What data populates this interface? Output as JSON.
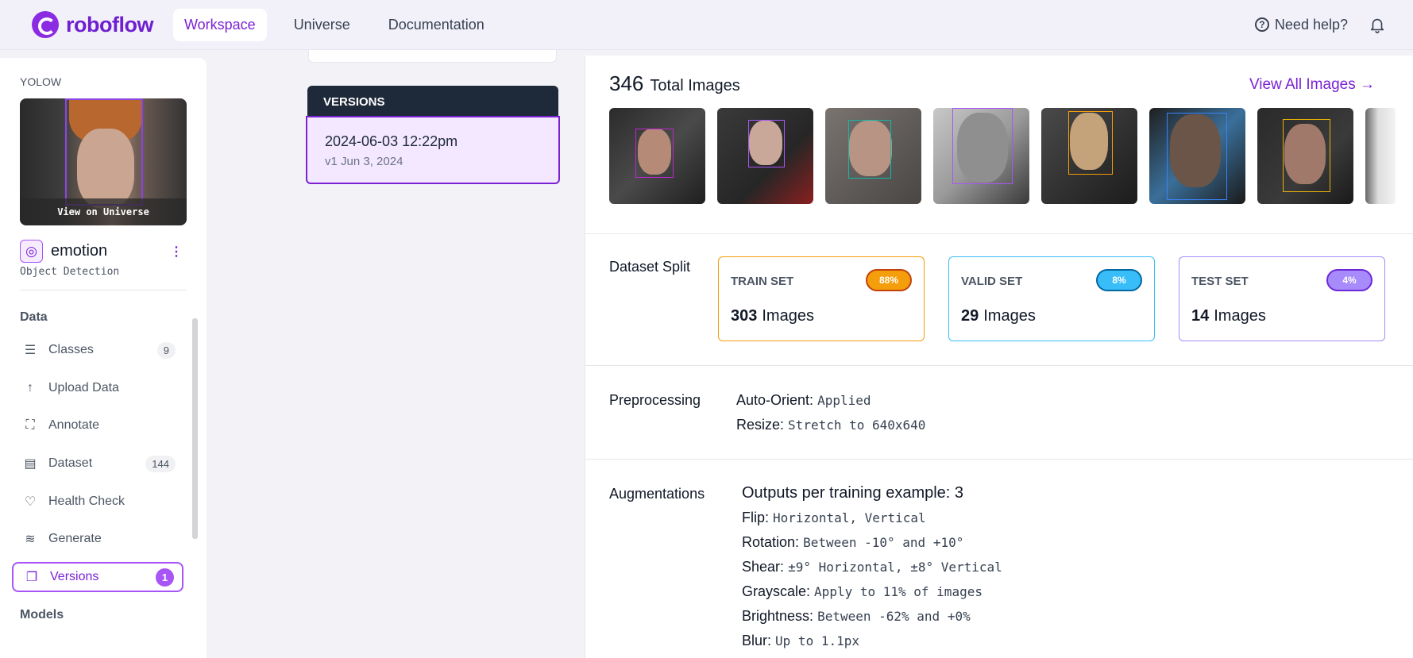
{
  "nav": {
    "logo_text": "roboflow",
    "links": [
      "Workspace",
      "Universe",
      "Documentation"
    ],
    "help_label": "Need help?"
  },
  "sidebar": {
    "owner": "YOLOW",
    "thumb_caption": "View on Universe",
    "project_name": "emotion",
    "project_type": "Object Detection",
    "sections": {
      "data": "Data",
      "models": "Models"
    },
    "items": [
      {
        "label": "Classes",
        "icon": "list-icon",
        "count": "9"
      },
      {
        "label": "Upload Data",
        "icon": "upload-icon",
        "count": ""
      },
      {
        "label": "Annotate",
        "icon": "annotate-icon",
        "count": ""
      },
      {
        "label": "Dataset",
        "icon": "dataset-icon",
        "count": "144"
      },
      {
        "label": "Health Check",
        "icon": "health-check-icon",
        "count": ""
      },
      {
        "label": "Generate",
        "icon": "generate-icon",
        "count": ""
      },
      {
        "label": "Versions",
        "icon": "versions-icon",
        "count": "1",
        "active": true
      }
    ]
  },
  "versions": {
    "header": "VERSIONS",
    "item": {
      "name": "2024-06-03 12:22pm",
      "sub": "v1 Jun 3, 2024"
    }
  },
  "main": {
    "total_count": "346",
    "total_label": "Total Images",
    "view_all": "View All Images →",
    "split": {
      "label": "Dataset Split",
      "cards": [
        {
          "title": "TRAIN SET",
          "badge": "88%",
          "count": "303",
          "unit": "Images",
          "color": "#f59e0b"
        },
        {
          "title": "VALID SET",
          "badge": "8%",
          "count": "29",
          "unit": "Images",
          "color": "#38bdf8"
        },
        {
          "title": "TEST SET",
          "badge": "4%",
          "count": "14",
          "unit": "Images",
          "color": "#a78bfa"
        }
      ]
    },
    "preprocessing": {
      "label": "Preprocessing",
      "items": [
        {
          "k": "Auto-Orient:",
          "v": "Applied"
        },
        {
          "k": "Resize:",
          "v": "Stretch to 640x640"
        }
      ]
    },
    "augmentations": {
      "label": "Augmentations",
      "outputs": "Outputs per training example: 3",
      "items": [
        {
          "k": "Flip:",
          "v": "Horizontal, Vertical"
        },
        {
          "k": "Rotation:",
          "v": "Between -10° and +10°"
        },
        {
          "k": "Shear:",
          "v": "±9° Horizontal, ±8° Vertical"
        },
        {
          "k": "Grayscale:",
          "v": "Apply to 11% of images"
        },
        {
          "k": "Brightness:",
          "v": "Between -62% and +0%"
        },
        {
          "k": "Blur:",
          "v": "Up to 1.1px"
        }
      ]
    }
  }
}
